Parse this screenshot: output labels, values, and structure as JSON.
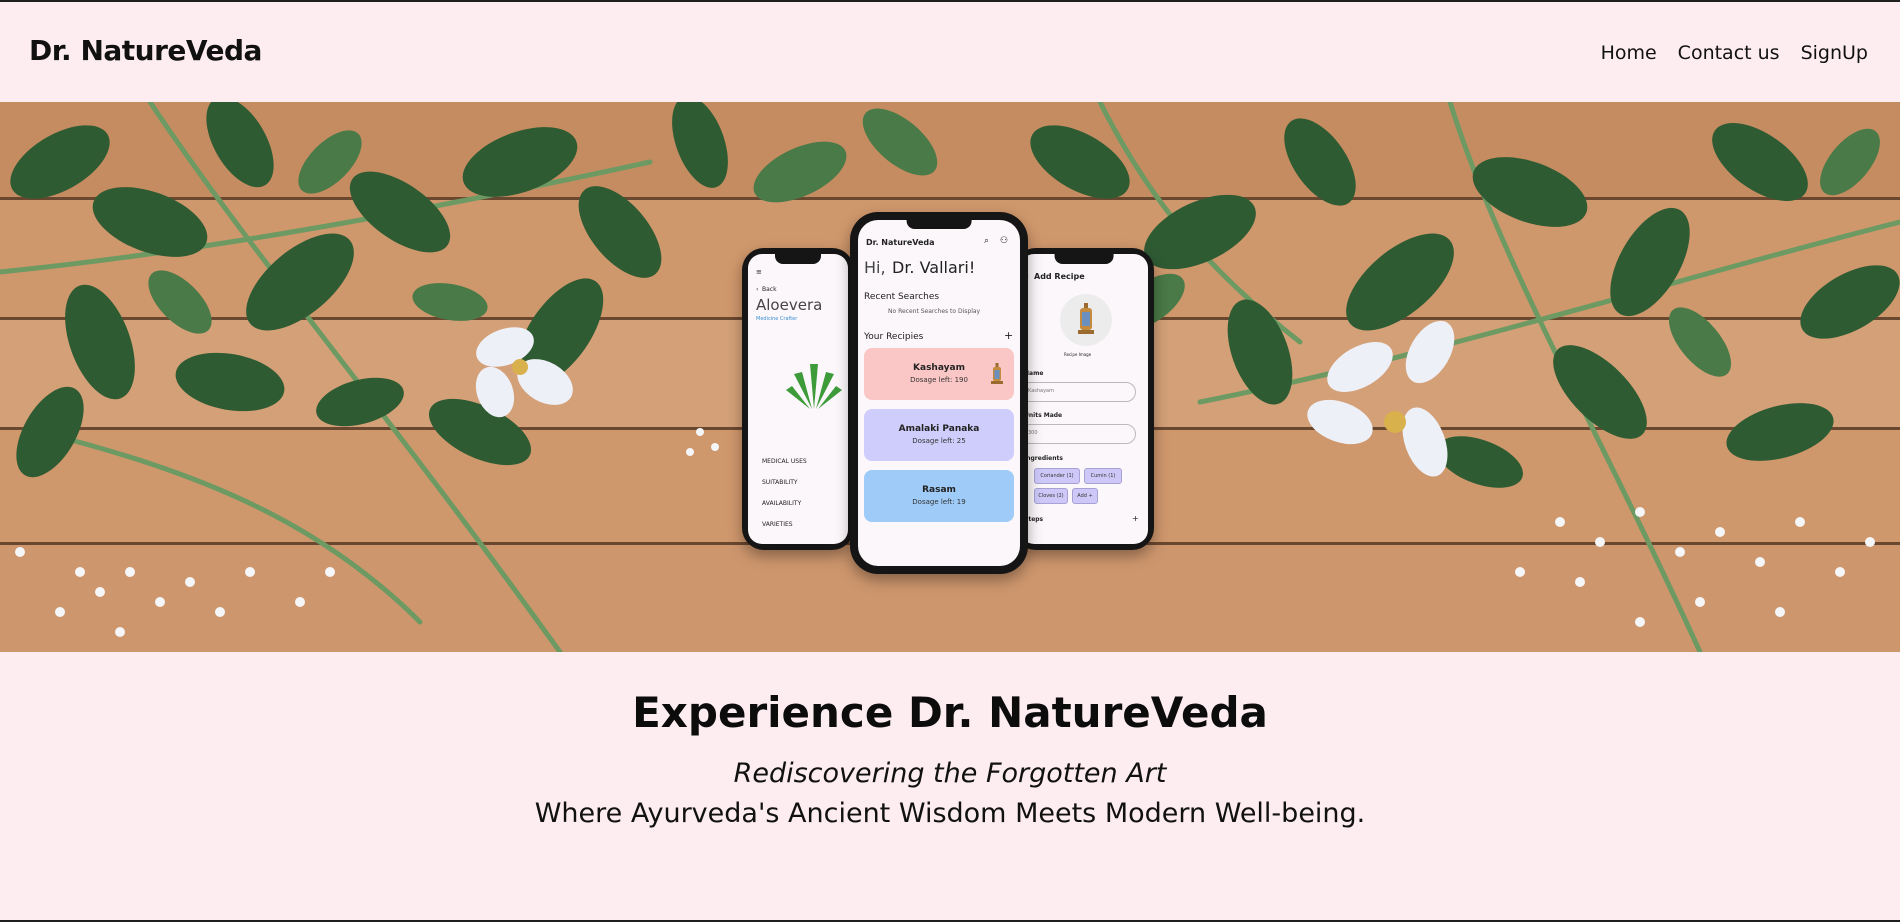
{
  "navbar": {
    "brand": "Dr. NatureVeda",
    "links": [
      "Home",
      "Contact us",
      "SignUp"
    ]
  },
  "hero": {
    "left_phone": {
      "back": "Back",
      "title": "Aloevera",
      "subtitle": "Medicine Crafter",
      "menu": [
        "MEDICAL USES",
        "SUITABILITY",
        "AVAILABILITY",
        "VARIETIES"
      ]
    },
    "center_phone": {
      "app_name": "Dr. NatureVeda",
      "greeting_hi": "Hi,",
      "greeting_name": "Dr. Vallari!",
      "recent_title": "Recent Searches",
      "recent_empty": "No Recent Searches to Display",
      "recipes_title": "Your Recipies",
      "recipes": [
        {
          "name": "Kashayam",
          "dosage": "Dosage left: 190",
          "color": "#fbc7c6"
        },
        {
          "name": "Amalaki Panaka",
          "dosage": "Dosage left: 25",
          "color": "#cfcdfb"
        },
        {
          "name": "Rasam",
          "dosage": "Dosage left: 19",
          "color": "#9ecbf7"
        }
      ]
    },
    "right_phone": {
      "title": "Add Recipe",
      "image_label": "Recipe Image",
      "name_label": "Name",
      "name_value": "Kashayam",
      "units_label": "Units Made",
      "units_value": "300",
      "ingredients_label": "Ingredients",
      "chips": [
        "Coriander (1)",
        "Cumin (1)",
        "Cloves (2)",
        "Add +"
      ],
      "bottom_label": "Steps"
    }
  },
  "content": {
    "headline": "Experience Dr. NatureVeda",
    "tagline": "Rediscovering the Forgotten Art",
    "subline": "Where Ayurveda's Ancient Wisdom Meets Modern Well-being."
  },
  "colors": {
    "page_bg": "#fdedf0",
    "text": "#111111"
  }
}
